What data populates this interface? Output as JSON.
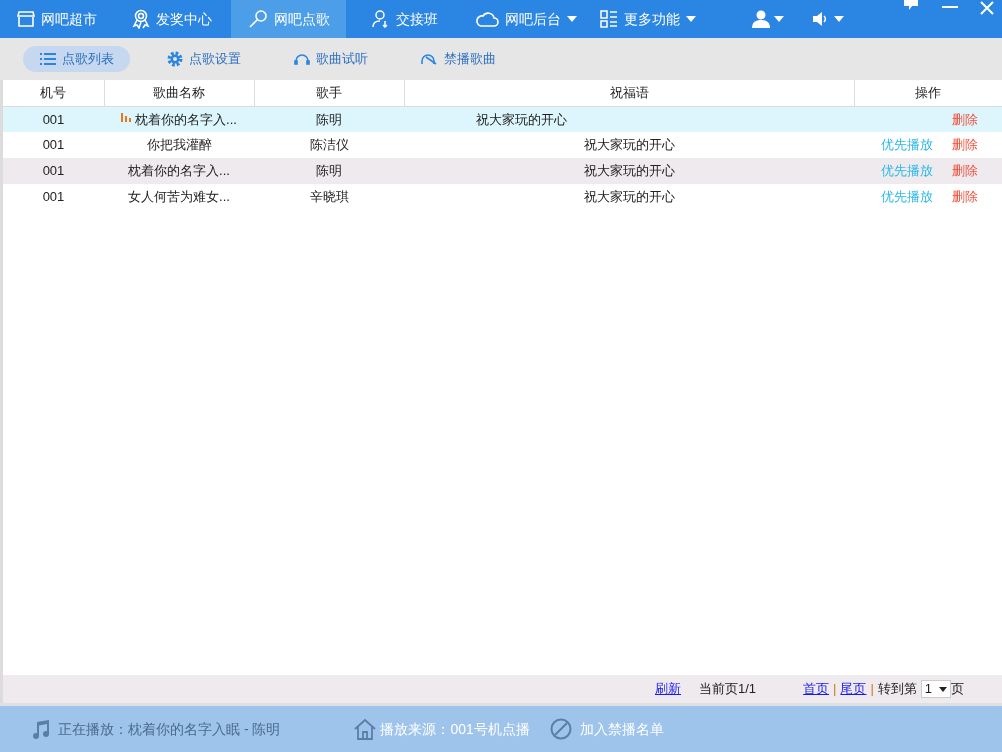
{
  "nav": [
    {
      "label": "网吧超市",
      "selected": false,
      "dropdown": false
    },
    {
      "label": "发奖中心",
      "selected": false,
      "dropdown": false
    },
    {
      "label": "网吧点歌",
      "selected": true,
      "dropdown": false
    },
    {
      "label": "交接班",
      "selected": false,
      "dropdown": false
    },
    {
      "label": "网吧后台",
      "selected": false,
      "dropdown": true
    },
    {
      "label": "更多功能",
      "selected": false,
      "dropdown": true
    }
  ],
  "subtabs": [
    {
      "label": "点歌列表",
      "selected": true
    },
    {
      "label": "点歌设置",
      "selected": false
    },
    {
      "label": "歌曲试听",
      "selected": false
    },
    {
      "label": "禁播歌曲",
      "selected": false
    }
  ],
  "table": {
    "columns": [
      "机号",
      "歌曲名称",
      "歌手",
      "祝福语",
      "操作"
    ],
    "rows": [
      {
        "machine": "001",
        "song": "枕着你的名字入...",
        "singer": "陈明",
        "message": "祝大家玩的开心",
        "playing": true,
        "actions": [
          "删除"
        ]
      },
      {
        "machine": "001",
        "song": "你把我灌醉",
        "singer": "陈洁仪",
        "message": "祝大家玩的开心",
        "playing": false,
        "actions": [
          "优先播放",
          "删除"
        ]
      },
      {
        "machine": "001",
        "song": "枕着你的名字入...",
        "singer": "陈明",
        "message": "祝大家玩的开心",
        "playing": false,
        "actions": [
          "优先播放",
          "删除"
        ]
      },
      {
        "machine": "001",
        "song": "女人何苦为难女...",
        "singer": "辛晓琪",
        "message": "祝大家玩的开心",
        "playing": false,
        "actions": [
          "优先播放",
          "删除"
        ]
      }
    ]
  },
  "pager": {
    "refresh": "刷新",
    "current": "当前页1/1",
    "first": "首页",
    "sep": "|",
    "last": "尾页",
    "goto": "转到第",
    "page": "1",
    "unit": "页"
  },
  "status": {
    "now_playing": "正在播放：枕着你的名字入眠 - 陈明",
    "source": "播放来源：001号机点播",
    "ban": "加入禁播名单"
  }
}
